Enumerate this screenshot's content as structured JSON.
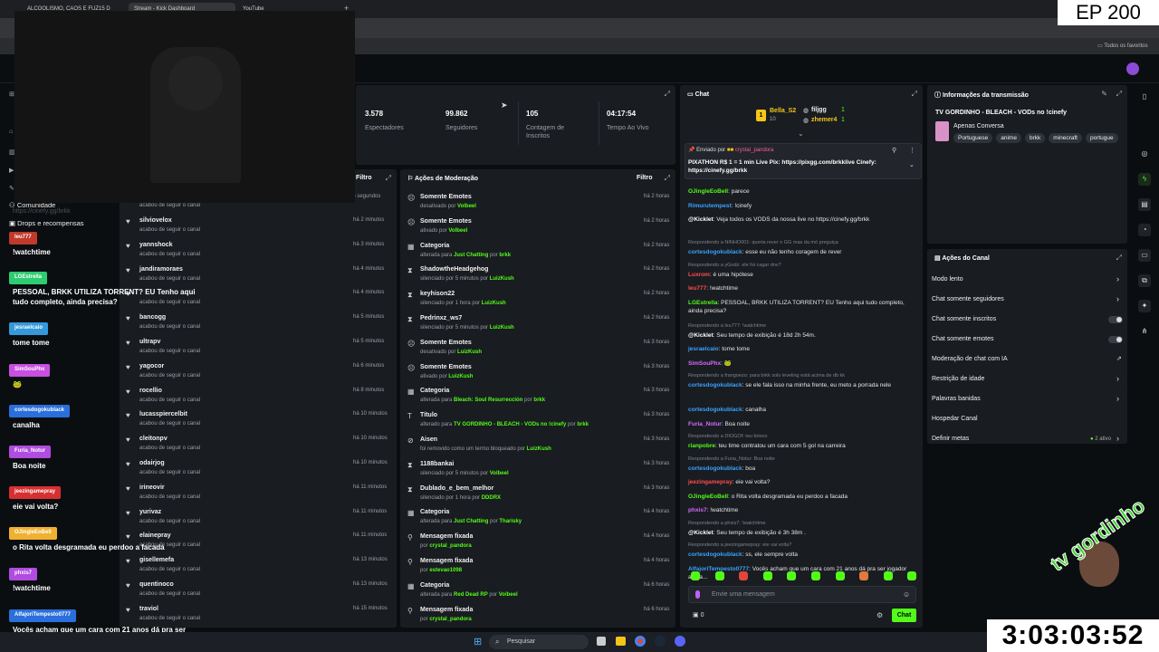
{
  "browser": {
    "tabs": [
      "ALCOOLISMO, CAOS E FUZ15 D",
      "Stream - Kick Dashboard",
      "YouTube"
    ],
    "bookmarks_folder": "Todos os favoritos"
  },
  "overlay": {
    "episode": "EP 200",
    "timer": "3:03:03:52",
    "logo_text": "tv gordinho"
  },
  "stats": [
    {
      "value": "3.578",
      "label": "Espectadores"
    },
    {
      "value": "99.862",
      "label": "Seguidores"
    },
    {
      "value": "105",
      "label": "Contagem de Inscritos"
    },
    {
      "value": "04:17:54",
      "label": "Tempo Ao Vivo"
    }
  ],
  "left_nav": {
    "items": [
      "Comunidade",
      "Drops e recompensas"
    ],
    "url": "https://cinefy.gg/brkk"
  },
  "activity": {
    "filter_label": "Filtro",
    "top_time": "16 segundos",
    "top_sub": "acabou de seguir o canal",
    "items": [
      {
        "user": "silviovelox",
        "sub": "acabou de seguir o canal",
        "time": "há 2 minutos"
      },
      {
        "user": "yannshock",
        "sub": "acabou de seguir o canal",
        "time": "há 3 minutos"
      },
      {
        "user": "jandiramoraes",
        "sub": "acabou de seguir o canal",
        "time": "há 4 minutos"
      },
      {
        "user": "",
        "sub": "acabou de seguir o canal",
        "time": "há 4 minutos"
      },
      {
        "user": "bancogg",
        "sub": "acabou de seguir o canal",
        "time": "há 5 minutos"
      },
      {
        "user": "ultrapv",
        "sub": "acabou de seguir o canal",
        "time": "há 5 minutos"
      },
      {
        "user": "yagocor",
        "sub": "acabou de seguir o canal",
        "time": "há 6 minutos"
      },
      {
        "user": "rocellio",
        "sub": "acabou de seguir o canal",
        "time": "há 8 minutos"
      },
      {
        "user": "lucasspiercelbit",
        "sub": "acabou de seguir o canal",
        "time": "há 10 minutos"
      },
      {
        "user": "cleitonpv",
        "sub": "acabou de seguir o canal",
        "time": "há 10 minutos"
      },
      {
        "user": "odairjog",
        "sub": "acabou de seguir o canal",
        "time": "há 10 minutos"
      },
      {
        "user": "irineovir",
        "sub": "acabou de seguir o canal",
        "time": "há 11 minutos"
      },
      {
        "user": "yurivaz",
        "sub": "acabou de seguir o canal",
        "time": "há 11 minutos"
      },
      {
        "user": "elainepray",
        "sub": "acabou de seguir o canal",
        "time": "há 11 minutos"
      },
      {
        "user": "gisellemefa",
        "sub": "acabou de seguir o canal",
        "time": "há 13 minutos"
      },
      {
        "user": "quentinoco",
        "sub": "acabou de seguir o canal",
        "time": "há 13 minutos"
      },
      {
        "user": "traviol",
        "sub": "acabou de seguir o canal",
        "time": "há 15 minutos"
      }
    ]
  },
  "moderation": {
    "title": "Ações de Moderação",
    "filter_label": "Filtro",
    "items": [
      {
        "icon": "emote-icon",
        "title": "Somente Emotes",
        "pre": "desativado por ",
        "who": "Volbeel",
        "mid": "",
        "who2": "",
        "time": "há 2 horas"
      },
      {
        "icon": "emote-icon",
        "title": "Somente Emotes",
        "pre": "ativado por ",
        "who": "Volbeel",
        "mid": "",
        "who2": "",
        "time": "há 2 horas"
      },
      {
        "icon": "category-icon",
        "title": "Categoria",
        "pre": "alterada para ",
        "who": "Just Chatting",
        "mid": " por ",
        "who2": "brkk",
        "time": "há 2 horas"
      },
      {
        "icon": "hourglass-icon",
        "title": "ShadowtheHeadgehog",
        "pre": "silenciado por 5 minutos por ",
        "who": "LuizKush",
        "mid": "",
        "who2": "",
        "time": "há 2 horas"
      },
      {
        "icon": "hourglass-icon",
        "title": "keyhison22",
        "pre": "silenciado por 1 hora por ",
        "who": "LuizKush",
        "mid": "",
        "who2": "",
        "time": "há 2 horas"
      },
      {
        "icon": "hourglass-icon",
        "title": "Pedrinxz_ws7",
        "pre": "silenciado por 5 minutos por ",
        "who": "LuizKush",
        "mid": "",
        "who2": "",
        "time": "há 2 horas"
      },
      {
        "icon": "emote-icon",
        "title": "Somente Emotes",
        "pre": "desativado por ",
        "who": "LuizKush",
        "mid": "",
        "who2": "",
        "time": "há 3 horas"
      },
      {
        "icon": "emote-icon",
        "title": "Somente Emotes",
        "pre": "ativado por ",
        "who": "LuizKush",
        "mid": "",
        "who2": "",
        "time": "há 3 horas"
      },
      {
        "icon": "category-icon",
        "title": "Categoria",
        "pre": "alterada para ",
        "who": "Bleach: Soul Resurrección",
        "mid": " por ",
        "who2": "brkk",
        "time": "há 3 horas"
      },
      {
        "icon": "title-icon",
        "title": "Título",
        "pre": "alterado para ",
        "who": "TV GORDINHO - BLEACH - VODs no !cinefy",
        "mid": " por ",
        "who2": "brkk",
        "time": "há 3 horas"
      },
      {
        "icon": "ban-icon",
        "title": "Aisen",
        "pre": "foi removido como um termo bloqueado por ",
        "who": "LuizKush",
        "mid": "",
        "who2": "",
        "time": "há 3 horas"
      },
      {
        "icon": "hourglass-icon",
        "title": "1188bankai",
        "pre": "silenciado por 5 minutos por ",
        "who": "Volbeel",
        "mid": "",
        "who2": "",
        "time": "há 3 horas"
      },
      {
        "icon": "hourglass-icon",
        "title": "Dublado_e_bem_melhor",
        "pre": "silenciado por 1 hora por ",
        "who": "DDDRX",
        "mid": "",
        "who2": "",
        "time": "há 3 horas"
      },
      {
        "icon": "category-icon",
        "title": "Categoria",
        "pre": "alterada para ",
        "who": "Just Chatting",
        "mid": " por ",
        "who2": "Tharisky",
        "time": "há 4 horas"
      },
      {
        "icon": "pin-icon",
        "title": "Mensagem fixada",
        "pre": "por ",
        "who": "crystal_pandora",
        "mid": "",
        "who2": "",
        "time": "há 4 horas"
      },
      {
        "icon": "pin-icon",
        "title": "Mensagem fixada",
        "pre": "por ",
        "who": "estevao1098",
        "mid": "",
        "who2": "",
        "time": "há 4 horas"
      },
      {
        "icon": "category-icon",
        "title": "Categoria",
        "pre": "alterada para ",
        "who": "Red Dead RP",
        "mid": " por ",
        "who2": "Volbeel",
        "time": "há 6 horas"
      },
      {
        "icon": "pin-icon",
        "title": "Mensagem fixada",
        "pre": "por ",
        "who": "crystal_pandora",
        "mid": "",
        "who2": "",
        "time": "há 6 horas"
      }
    ]
  },
  "chat": {
    "title": "Chat",
    "top_gifters": [
      {
        "name": "Bella_S2",
        "count": "10"
      },
      {
        "name": "filjgg",
        "count": "1"
      },
      {
        "name": "zhemer4",
        "count": "1"
      }
    ],
    "pinned": {
      "label": "Enviado por",
      "author": "crystal_pandora",
      "text": "PIXATHON R$ 1 = 1 min Live Pix: https://pixgg.com/brkklive Cinefy: https://cinefy.gg/brkk"
    },
    "messages": [
      {
        "kind": "msg",
        "user": "OJingleEoBell",
        "color": "#53fc18",
        "text": "parece"
      },
      {
        "kind": "msg",
        "user": "Rimurutempest",
        "color": "#3aa3ff",
        "text": "!cinefy"
      },
      {
        "kind": "msg",
        "user": "@Kicklet",
        "color": "#ffffff",
        "text": "Veja todos os VODS da nossa live no https://cinefy.gg/brkk"
      },
      {
        "kind": "reply",
        "text": "Respondendo a NINHO001: queria rever o GG mas da mó preguiça"
      },
      {
        "kind": "msg",
        "user": "cortesdogokublack",
        "color": "#3aa3ff",
        "text": "esse eu não tenho coragem de rever"
      },
      {
        "kind": "reply",
        "text": "Respondendo a yGodz: ele foi cagar dnv?"
      },
      {
        "kind": "msg",
        "user": "Luxrom",
        "color": "#ff4d4d",
        "text": "é uma hipótese"
      },
      {
        "kind": "msg",
        "user": "leu777",
        "color": "#ff4d4d",
        "text": "!watchtime"
      },
      {
        "kind": "msg",
        "user": "LGEstrella",
        "color": "#53fc18",
        "text": "PESSOAL, BRKK UTILIZA TORRENT? EU Tenho aqui tudo completo, ainda precisa?"
      },
      {
        "kind": "reply",
        "text": "Respondendo a leu777: !watchtime"
      },
      {
        "kind": "msg",
        "user": "@Kicklet",
        "color": "#ffffff",
        "text": "Seu tempo de exibição é 18d 2h 54m."
      },
      {
        "kind": "msg",
        "user": "jesraelcaio",
        "color": "#3aa3ff",
        "text": "tome tome"
      },
      {
        "kind": "msg",
        "user": "SimSouPhx",
        "color": "#d36bff",
        "text": "🐸"
      },
      {
        "kind": "reply",
        "text": "Respondendo a frangoezo: para brkk solo leveling está acima de db kk"
      },
      {
        "kind": "msg",
        "user": "cortesdogokublack",
        "color": "#3aa3ff",
        "text": "se ele fala isso na minha frente, eu meto a porrada nele"
      },
      {
        "kind": "msg",
        "user": "cortesdogokublack",
        "color": "#3aa3ff",
        "text": "canalha"
      },
      {
        "kind": "msg",
        "user": "Furia_Notur",
        "color": "#d36bff",
        "text": "Boa noite"
      },
      {
        "kind": "reply",
        "text": "Respondendo a DIOGOf: teu brioco"
      },
      {
        "kind": "msg",
        "user": "rianpobre",
        "color": "#53fc18",
        "text": "teu time contratou um cara com 5 gol na carreira"
      },
      {
        "kind": "reply",
        "text": "Respondendo a Furia_Notur: Boa noite"
      },
      {
        "kind": "msg",
        "user": "cortesdogokublack",
        "color": "#3aa3ff",
        "text": "boa"
      },
      {
        "kind": "msg",
        "user": "jeezingamepray",
        "color": "#ff4d4d",
        "text": "eie vai volta?"
      },
      {
        "kind": "msg",
        "user": "OJingleEoBell",
        "color": "#53fc18",
        "text": "o Rita volta desgramada eu perdoo a facada"
      },
      {
        "kind": "msg",
        "user": "phxis7",
        "color": "#d36bff",
        "text": "!watchtime"
      },
      {
        "kind": "reply",
        "text": "Respondendo a phxis7: !watchtime"
      },
      {
        "kind": "msg",
        "user": "@Kicklet",
        "color": "#ffffff",
        "text": "Seu tempo de exibição é 3h 38m ."
      },
      {
        "kind": "reply",
        "text": "Respondendo a jeezingamepray: eie vai volta?"
      },
      {
        "kind": "msg",
        "user": "cortesdogokublack",
        "color": "#3aa3ff",
        "text": "ss, ele sempre volta"
      },
      {
        "kind": "msg",
        "user": "AlfajoriTempesto0777",
        "color": "#3aa3ff",
        "text": "Vocês acham que um cara com 21 anos dá pra ser jogador ainda..."
      }
    ],
    "input_placeholder": "Envie uma mensagem",
    "viewer_count": "0",
    "send_label": "Chat"
  },
  "stream_info": {
    "title": "Informações da transmissão",
    "stream_title": "TV GORDINHO - BLEACH - VODs no !cinefy",
    "category": "Apenas Conversa",
    "tags": [
      "Portuguese",
      "anime",
      "brkk",
      "minecraft",
      "portugue"
    ]
  },
  "channel_actions": {
    "title": "Ações do Canal",
    "items": [
      {
        "label": "Modo lento",
        "control": "chevron"
      },
      {
        "label": "Chat somente seguidores",
        "control": "chevron"
      },
      {
        "label": "Chat somente inscritos",
        "control": "toggle"
      },
      {
        "label": "Chat somente emotes",
        "control": "toggle"
      },
      {
        "label": "Moderação de chat com IA",
        "control": "external"
      },
      {
        "label": "Restrição de idade",
        "control": "chevron"
      },
      {
        "label": "Palavras banidas",
        "control": "chevron"
      },
      {
        "label": "Hospedar Canal",
        "control": "none"
      },
      {
        "label": "Definir metas",
        "control": "chevron",
        "badge": "2 ativo"
      }
    ]
  },
  "overlay_chat": [
    {
      "user": "leu777",
      "color": "#c0392b",
      "text": "!watchtime"
    },
    {
      "user": "LGEstrella",
      "color": "#2ecc71",
      "text": "PESSOAL, BRKK UTILIZA TORRENT? EU Tenho aqui\ntudo completo, ainda precisa?"
    },
    {
      "user": "jesraelcaio",
      "color": "#3498db",
      "text": "tome tome"
    },
    {
      "user": "SimSouPhx",
      "color": "#c84fe0",
      "text": "🐸"
    },
    {
      "user": "cortesdogokublack",
      "color": "#2a6fdb",
      "text": "canalha"
    },
    {
      "user": "Furia_Notur",
      "color": "#b04ce0",
      "text": "Boa noite"
    },
    {
      "user": "jeezingamepray",
      "color": "#d63031",
      "text": "eie vai volta?"
    },
    {
      "user": "OJingleEoBell",
      "color": "#f0b030",
      "text": "o Rita volta desgramada eu perdoo a facada"
    },
    {
      "user": "phxis7",
      "color": "#b04ce0",
      "text": "!watchtime"
    },
    {
      "user": "AlfajoriTempesto0777",
      "color": "#2a6fdb",
      "text": "Vocês acham que um cara com 21 anos dá pra ser\njogador ainda..."
    }
  ],
  "taskbar": {
    "search_label": "Pesquisar"
  }
}
